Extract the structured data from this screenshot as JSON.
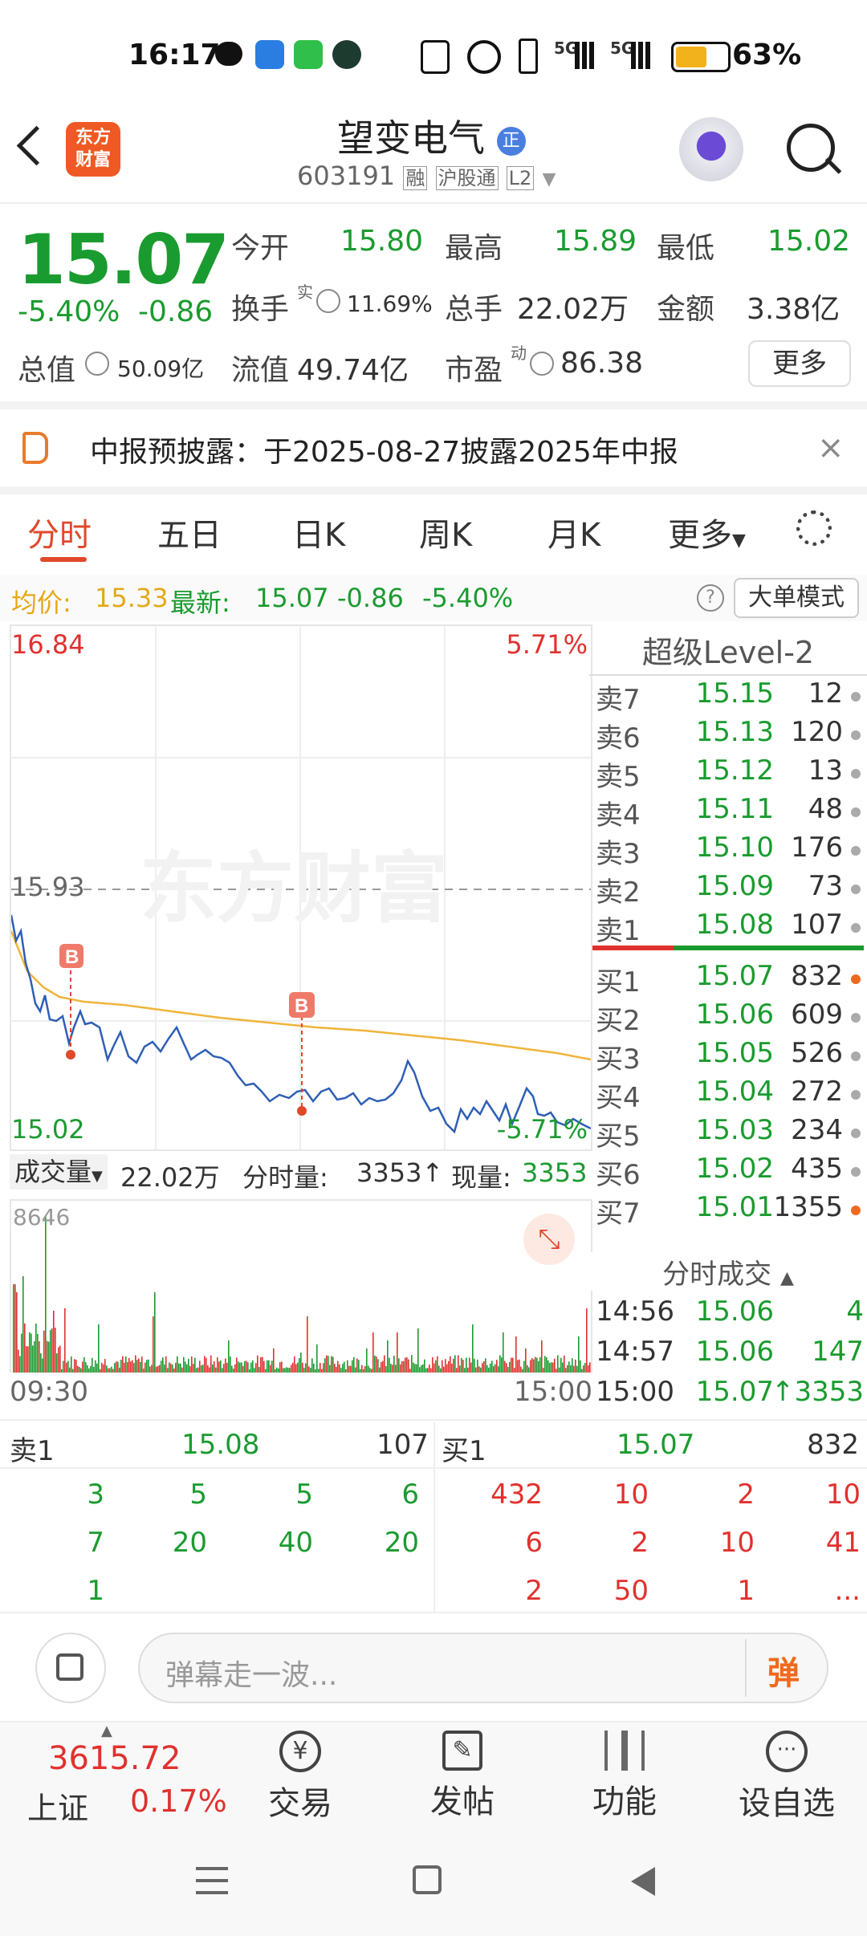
{
  "status_bar": {
    "time": "16:17",
    "battery": "63%",
    "network1": "5G",
    "network2": "5G"
  },
  "header": {
    "logo_line1": "东方",
    "logo_line2": "财富",
    "title": "望变电气",
    "title_badge": "正",
    "code": "603191",
    "tag_rong": "融",
    "tag_hgt": "沪股通",
    "tag_l2": "L2"
  },
  "quote": {
    "price": "15.07",
    "change_pct": "-5.40%",
    "change": "-0.86",
    "open_label": "今开",
    "open": "15.80",
    "high_label": "最高",
    "high": "15.89",
    "low_label": "最低",
    "low": "15.02",
    "turnover_label": "换手",
    "turnover_sup": "实",
    "turnover": "11.69%",
    "volume_label": "总手",
    "volume": "22.02万",
    "amount_label": "金额",
    "amount": "3.38亿",
    "mktcap_label": "总值",
    "mktcap": "50.09亿",
    "float_label": "流值",
    "float": "49.74亿",
    "pe_label": "市盈",
    "pe_sup": "动",
    "pe": "86.38",
    "more": "更多"
  },
  "notice": {
    "text": "中报预披露：于2025-08-27披露2025年中报"
  },
  "tabs": [
    "分时",
    "五日",
    "日K",
    "周K",
    "月K",
    "更多"
  ],
  "infobar": {
    "avg_label": "均价:",
    "avg": "15.33",
    "latest_label": "最新:",
    "latest": "15.07",
    "chg": "-0.86",
    "pct": "-5.40%",
    "mode": "大单模式"
  },
  "chart": {
    "top_price": "16.84",
    "top_pct": "5.71%",
    "mid_price": "15.93",
    "bottom_price": "15.02",
    "bottom_pct": "-5.71%",
    "watermark": "东方财富",
    "marker": "B",
    "vol_label": "成交量",
    "vol_total": "22.02万",
    "tick_label": "分时量:",
    "tick_vol": "3353↑",
    "now_label": "现量:",
    "now_vol": "3353",
    "vol_max": "8646",
    "time_start": "09:30",
    "time_end": "15:00"
  },
  "orderbook": {
    "title": "超级Level-2",
    "asks": [
      {
        "name": "卖7",
        "price": "15.15",
        "qty": "12"
      },
      {
        "name": "卖6",
        "price": "15.13",
        "qty": "120"
      },
      {
        "name": "卖5",
        "price": "15.12",
        "qty": "13"
      },
      {
        "name": "卖4",
        "price": "15.11",
        "qty": "48"
      },
      {
        "name": "卖3",
        "price": "15.10",
        "qty": "176"
      },
      {
        "name": "卖2",
        "price": "15.09",
        "qty": "73"
      },
      {
        "name": "卖1",
        "price": "15.08",
        "qty": "107"
      }
    ],
    "bids": [
      {
        "name": "买1",
        "price": "15.07",
        "qty": "832"
      },
      {
        "name": "买2",
        "price": "15.06",
        "qty": "609"
      },
      {
        "name": "买3",
        "price": "15.05",
        "qty": "526"
      },
      {
        "name": "买4",
        "price": "15.04",
        "qty": "272"
      },
      {
        "name": "买5",
        "price": "15.03",
        "qty": "234"
      },
      {
        "name": "买6",
        "price": "15.02",
        "qty": "435"
      },
      {
        "name": "买7",
        "price": "15.01",
        "qty": "1355"
      }
    ],
    "trades_title": "分时成交",
    "trades": [
      {
        "time": "14:56",
        "price": "15.06",
        "qty": "4"
      },
      {
        "time": "14:57",
        "price": "15.06",
        "qty": "147"
      },
      {
        "time": "15:00",
        "price": "15.07",
        "qty": "↑3353"
      }
    ]
  },
  "queue": {
    "sell_label": "卖1",
    "sell_price": "15.08",
    "sell_qty": "107",
    "buy_label": "买1",
    "buy_price": "15.07",
    "buy_qty": "832",
    "sell_rows": [
      [
        "3",
        "5",
        "5",
        "6"
      ],
      [
        "7",
        "20",
        "40",
        "20"
      ],
      [
        "1",
        "",
        "",
        ""
      ]
    ],
    "buy_rows": [
      [
        "432",
        "10",
        "2",
        "10"
      ],
      [
        "6",
        "2",
        "10",
        "41"
      ],
      [
        "2",
        "50",
        "1",
        "..."
      ]
    ]
  },
  "comment": {
    "placeholder": "弹幕走一波...",
    "danmu": "弹"
  },
  "bottom": {
    "index_value": "3615.72",
    "index_name": "上证",
    "index_pct": "0.17%",
    "trade": "交易",
    "post": "发帖",
    "func": "功能",
    "watch": "设自选"
  }
}
